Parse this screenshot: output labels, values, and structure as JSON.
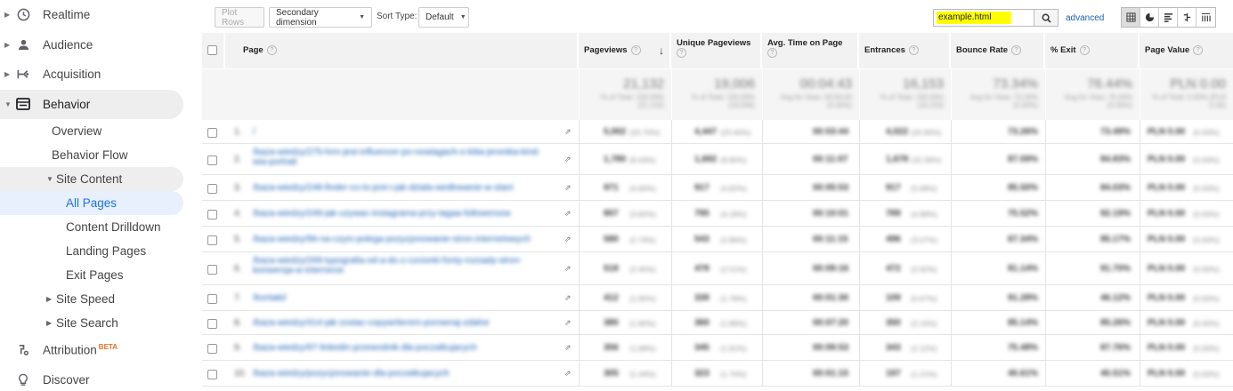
{
  "sidebar": {
    "realtime": "Realtime",
    "audience": "Audience",
    "acquisition": "Acquisition",
    "behavior": "Behavior",
    "overview": "Overview",
    "behavior_flow": "Behavior Flow",
    "site_content": "Site Content",
    "all_pages": "All Pages",
    "content_drilldown": "Content Drilldown",
    "landing_pages": "Landing Pages",
    "exit_pages": "Exit Pages",
    "site_speed": "Site Speed",
    "site_search": "Site Search",
    "attribution": "Attribution",
    "attribution_badge": "BETA",
    "discover": "Discover"
  },
  "toolbar": {
    "plot_rows": "Plot Rows",
    "secondary_dimension": "Secondary dimension",
    "sort_type_label": "Sort Type:",
    "sort_type_value": "Default",
    "search_value": "example.html",
    "advanced": "advanced"
  },
  "columns": {
    "page": "Page",
    "pageviews": "Pageviews",
    "unique_pageviews": "Unique Pageviews",
    "avg_time": "Avg. Time on Page",
    "entrances": "Entrances",
    "bounce_rate": "Bounce Rate",
    "exit": "% Exit",
    "page_value": "Page Value"
  },
  "totals": {
    "pageviews": "21,132",
    "unique_pageviews": "19,006",
    "avg_time": "00:04:43",
    "entrances": "16,153",
    "bounce_rate": "73.34%",
    "exit": "76.44%",
    "page_value": "PLN 0.00",
    "pageviews_sub": "% of Total: 100.00% (21,132)",
    "unique_pageviews_sub": "% of Total: 100.00% (19,006)",
    "avg_time_sub": "Avg for View: 00:04:43 (0.00%)",
    "entrances_sub": "% of Total: 100.00% (16,153)",
    "bounce_rate_sub": "Avg for View: 73.34% (0.00%)",
    "exit_sub": "Avg for View: 76.44% (0.00%)",
    "page_value_sub": "% of Total: 0.00% (PLN 0.00)"
  },
  "rows": [
    {
      "n": "1.",
      "page": "/",
      "pv": "5,002",
      "pvp": "(23.70%)",
      "upv": "4,447",
      "upvp": "(23.40%)",
      "t": "00:03:44",
      "e": "4,022",
      "ep": "(24.90%)",
      "br": "73.26%",
      "ex": "73.49%",
      "v": "PLN 0.00",
      "vp": "(0.00%)"
    },
    {
      "n": "2.",
      "page": "/baza-wiedzy/275-hrm-jest-influencer-po-nowiagach-o-kitia-jeronika-kind-wia-portrait",
      "pv": "1,780",
      "pvp": "(8.43%)",
      "upv": "1,692",
      "upvp": "(8.90%)",
      "t": "00:11:07",
      "e": "1,678",
      "ep": "(10.39%)",
      "br": "87.59%",
      "ex": "84.83%",
      "v": "PLN 0.00",
      "vp": "(0.00%)"
    },
    {
      "n": "3.",
      "page": "/baza-wiedzy/248-finder-co-to-jest-i-jak-dziala-wedlowanie-w-stani",
      "pv": "971",
      "pvp": "(4.60%)",
      "upv": "917",
      "upvp": "(4.82%)",
      "t": "00:05:53",
      "e": "917",
      "ep": "(5.68%)",
      "br": "85.50%",
      "ex": "84.03%",
      "v": "PLN 0.00",
      "vp": "(0.00%)"
    },
    {
      "n": "4.",
      "page": "/baza-wiedzy/249-jak-uzywac-instagrama-przy-tagaa-followersow",
      "pv": "807",
      "pvp": "(3.82%)",
      "upv": "795",
      "upvp": "(4.18%)",
      "t": "00:10:01",
      "e": "789",
      "ep": "(4.88%)",
      "br": "75.52%",
      "ex": "92.19%",
      "v": "PLN 0.00",
      "vp": "(0.00%)"
    },
    {
      "n": "5.",
      "page": "/baza-wiedzy/96-na-czym-polega-pozycjonowanie-stron-internetowych",
      "pv": "580",
      "pvp": "(2.74%)",
      "upv": "543",
      "upvp": "(2.86%)",
      "t": "00:11:15",
      "e": "496",
      "ep": "(3.07%)",
      "br": "67.34%",
      "ex": "85.17%",
      "v": "PLN 0.00",
      "vp": "(0.00%)"
    },
    {
      "n": "6.",
      "page": "/baza-wiedzy/269-typografia-od-a-do-z-czcionki-fonty-rozsady-stron-konwersja-w-internecie",
      "pv": "518",
      "pvp": "(2.45%)",
      "upv": "478",
      "upvp": "(2.51%)",
      "t": "00:09:16",
      "e": "472",
      "ep": "(2.92%)",
      "br": "81.14%",
      "ex": "91.70%",
      "v": "PLN 0.00",
      "vp": "(0.00%)"
    },
    {
      "n": "7.",
      "page": "/kontakt/",
      "pv": "412",
      "pvp": "(1.95%)",
      "upv": "339",
      "upvp": "(1.78%)",
      "t": "00:01:30",
      "e": "109",
      "ep": "(0.67%)",
      "br": "91.28%",
      "ex": "46.12%",
      "v": "PLN 0.00",
      "vp": "(0.00%)"
    },
    {
      "n": "8.",
      "page": "/baza-wiedzy/414-jak-zostac-copywriterem-porownaj-zdalne",
      "pv": "380",
      "pvp": "(1.80%)",
      "upv": "360",
      "upvp": "(1.89%)",
      "t": "00:07:20",
      "e": "350",
      "ep": "(2.16%)",
      "br": "85.14%",
      "ex": "85.26%",
      "v": "PLN 0.00",
      "vp": "(0.00%)"
    },
    {
      "n": "9.",
      "page": "/baza-wiedzy/97-linkedin-przewodnik-dla-poczatkujacych",
      "pv": "356",
      "pvp": "(1.68%)",
      "upv": "345",
      "upvp": "(1.81%)",
      "t": "00:09:53",
      "e": "343",
      "ep": "(2.12%)",
      "br": "75.48%",
      "ex": "87.76%",
      "v": "PLN 0.00",
      "vp": "(0.00%)"
    },
    {
      "n": "10.",
      "page": "/baza-wiedzy/pozycjonowanie-dla-poczatkujacych",
      "pv": "305",
      "pvp": "(1.44%)",
      "upv": "323",
      "upvp": "(1.70%)",
      "t": "00:01:15",
      "e": "197",
      "ep": "(1.21%)",
      "br": "40.61%",
      "ex": "40.51%",
      "v": "PLN 0.00",
      "vp": "(0.00%)"
    }
  ]
}
